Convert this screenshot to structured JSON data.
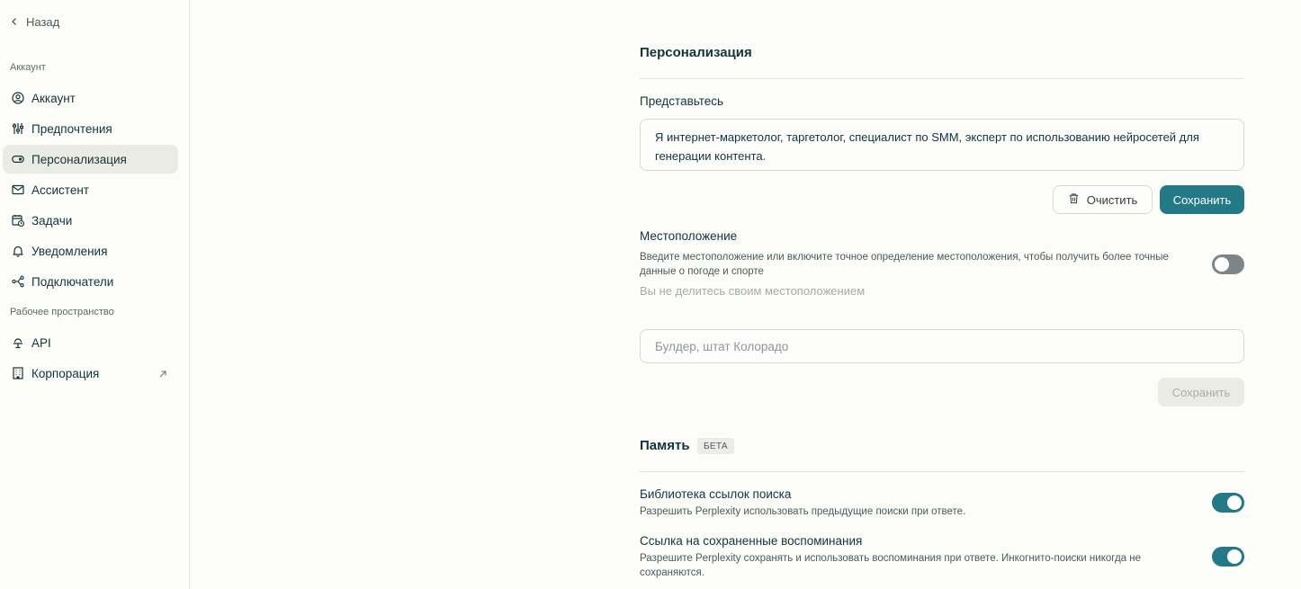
{
  "sidebar": {
    "back_label": "Назад",
    "section_account": "Аккаунт",
    "section_workspace": "Рабочее пространство",
    "items": [
      {
        "label": "Аккаунт",
        "icon": "user-circle-icon"
      },
      {
        "label": "Предпочтения",
        "icon": "sliders-icon"
      },
      {
        "label": "Персонализация",
        "icon": "toggle-icon"
      },
      {
        "label": "Ассистент",
        "icon": "mail-icon"
      },
      {
        "label": "Задачи",
        "icon": "calendar-clock-icon"
      },
      {
        "label": "Уведомления",
        "icon": "bell-icon"
      },
      {
        "label": "Подключатели",
        "icon": "connectors-icon"
      },
      {
        "label": "API",
        "icon": "api-icon"
      },
      {
        "label": "Корпорация",
        "icon": "building-icon"
      }
    ],
    "active_item": "Персонализация"
  },
  "personalization": {
    "title": "Персонализация",
    "intro_label": "Представьтесь",
    "intro_value": "Я интернет-маркетолог, таргетолог, специалист по SMM, эксперт по использованию нейросетей для генерации контента.",
    "clear_label": "Очистить",
    "save_label": "Сохранить"
  },
  "location": {
    "title": "Местоположение",
    "description": "Введите местоположение или включите точное определение местоположения, чтобы получить более точные данные о погоде и спорте",
    "status": "Вы не делитесь своим местоположением",
    "placeholder": "Булдер, штат Колорадо",
    "save_label": "Сохранить",
    "toggle_on": false
  },
  "memory": {
    "title": "Память",
    "badge": "БЕТА",
    "items": [
      {
        "title": "Библиотека ссылок поиска",
        "description": "Разрешить Perplexity использовать предыдущие поиски при ответе.",
        "enabled": true
      },
      {
        "title": "Ссылка на сохраненные воспоминания",
        "description": "Разрешите Perplexity сохранять и использовать воспоминания при ответе. Инкогнито-поиски никогда не сохраняются.",
        "enabled": true
      }
    ]
  },
  "colors": {
    "accent": "#237a86",
    "background": "#fcfcf9",
    "active_nav": "#ebebe5"
  }
}
